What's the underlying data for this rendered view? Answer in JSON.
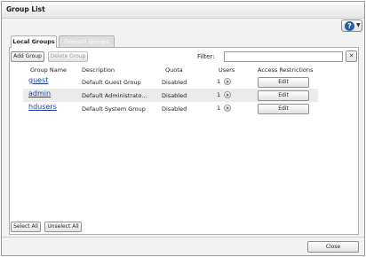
{
  "window": {
    "title": "Group List"
  },
  "help": {
    "glyph": "?",
    "caret": "▼"
  },
  "tabs": [
    {
      "label": "Local Groups",
      "active": true
    },
    {
      "label": "Domain Groups",
      "active": false
    }
  ],
  "toolbar": {
    "add_group": "Add Group",
    "delete_group": "Delete Group",
    "filter_label": "Filter:",
    "filter_value": "",
    "clear_glyph": "✕"
  },
  "table": {
    "headers": [
      "Group Name",
      "Description",
      "Quota",
      "Users",
      "Access Restrictions"
    ],
    "rows": [
      {
        "name": "guest",
        "description": "Default Guest Group",
        "quota": "Disabled",
        "users": "1",
        "action": "Edit"
      },
      {
        "name": "admin",
        "description": "Default Administrato...",
        "quota": "Disabled",
        "users": "1",
        "action": "Edit"
      },
      {
        "name": "hdusers",
        "description": "Default System Group",
        "quota": "Disabled",
        "users": "1",
        "action": "Edit"
      }
    ]
  },
  "footer": {
    "select_all": "Select All",
    "unselect_all": "Unselect All",
    "close": "Close"
  },
  "colors": {
    "link": "#1a3f9c",
    "help_accent": "#2a5fa8"
  }
}
